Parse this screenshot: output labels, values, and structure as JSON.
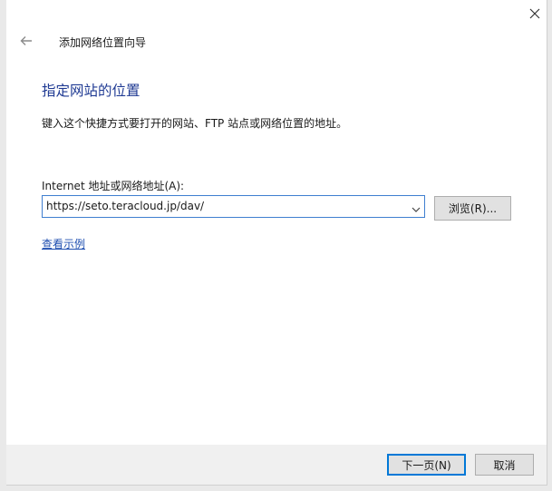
{
  "window": {
    "title": "添加网络位置向导",
    "close_icon": "close-icon",
    "back_icon": "back-arrow-icon"
  },
  "page": {
    "heading": "指定网站的位置",
    "description": "键入这个快捷方式要打开的网站、FTP 站点或网络位置的地址。"
  },
  "address": {
    "label": "Internet 地址或网络地址(A):",
    "value": "https://seto.teracloud.jp/dav/",
    "dropdown_icon": "chevron-down-icon"
  },
  "buttons": {
    "browse": "浏览(R)...",
    "next": "下一页(N)",
    "cancel": "取消"
  },
  "links": {
    "view_example": "查看示例"
  },
  "colors": {
    "heading": "#1f3a93",
    "link": "#1f4fb0",
    "focus_border": "#0078d7"
  }
}
